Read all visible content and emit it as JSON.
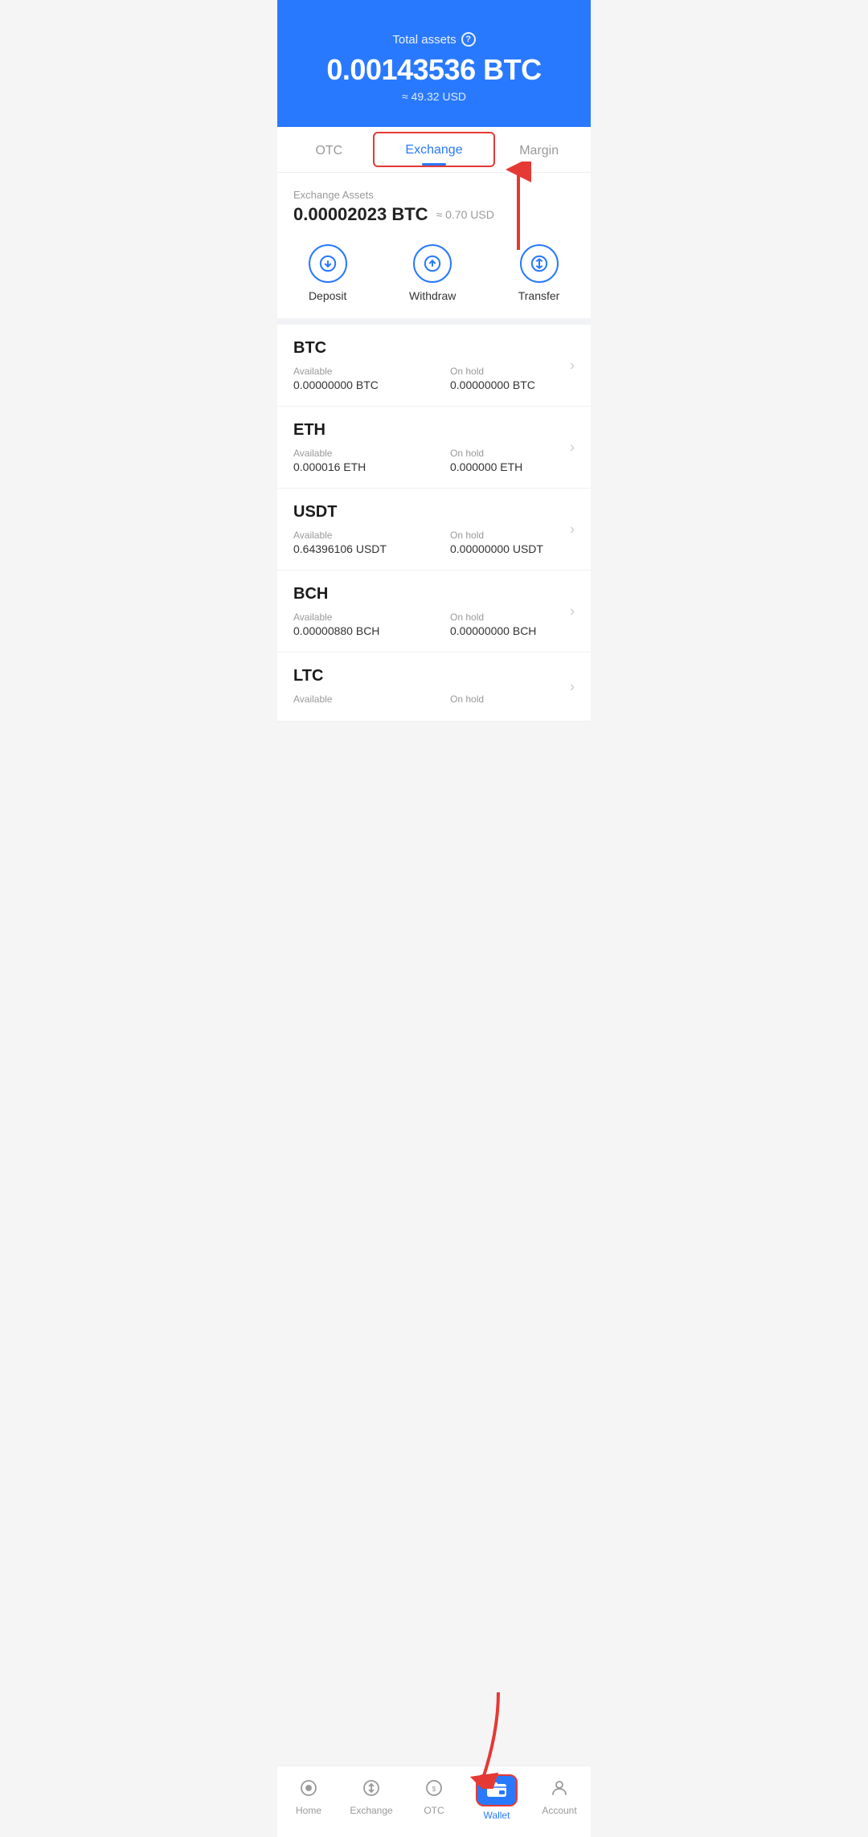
{
  "header": {
    "total_assets_label": "Total assets",
    "info_icon": "?",
    "btc_amount": "0.00143536 BTC",
    "usd_approx": "≈ 49.32 USD"
  },
  "tabs": [
    {
      "id": "otc",
      "label": "OTC",
      "active": false
    },
    {
      "id": "exchange",
      "label": "Exchange",
      "active": true
    },
    {
      "id": "margin",
      "label": "Margin",
      "active": false
    }
  ],
  "exchange_section": {
    "assets_label": "Exchange Assets",
    "assets_btc": "0.00002023 BTC",
    "assets_usd": "≈ 0.70 USD"
  },
  "actions": [
    {
      "id": "deposit",
      "label": "Deposit",
      "icon": "down-circle"
    },
    {
      "id": "withdraw",
      "label": "Withdraw",
      "icon": "up-circle"
    },
    {
      "id": "transfer",
      "label": "Transfer",
      "icon": "transfer-circle"
    }
  ],
  "assets": [
    {
      "name": "BTC",
      "available_label": "Available",
      "available_value": "0.00000000 BTC",
      "onhold_label": "On hold",
      "onhold_value": "0.00000000 BTC"
    },
    {
      "name": "ETH",
      "available_label": "Available",
      "available_value": "0.000016 ETH",
      "onhold_label": "On hold",
      "onhold_value": "0.000000 ETH"
    },
    {
      "name": "USDT",
      "available_label": "Available",
      "available_value": "0.64396106 USDT",
      "onhold_label": "On hold",
      "onhold_value": "0.00000000 USDT"
    },
    {
      "name": "BCH",
      "available_label": "Available",
      "available_value": "0.00000880 BCH",
      "onhold_label": "On hold",
      "onhold_value": "0.00000000 BCH"
    },
    {
      "name": "LTC",
      "available_label": "Available",
      "available_value": "",
      "onhold_label": "On hold",
      "onhold_value": ""
    }
  ],
  "bottom_nav": [
    {
      "id": "home",
      "label": "Home",
      "active": false,
      "icon": "home"
    },
    {
      "id": "exchange",
      "label": "Exchange",
      "active": false,
      "icon": "exchange"
    },
    {
      "id": "otc",
      "label": "OTC",
      "active": false,
      "icon": "otc"
    },
    {
      "id": "wallet",
      "label": "Wallet",
      "active": true,
      "icon": "wallet"
    },
    {
      "id": "account",
      "label": "Account",
      "active": false,
      "icon": "account"
    }
  ]
}
